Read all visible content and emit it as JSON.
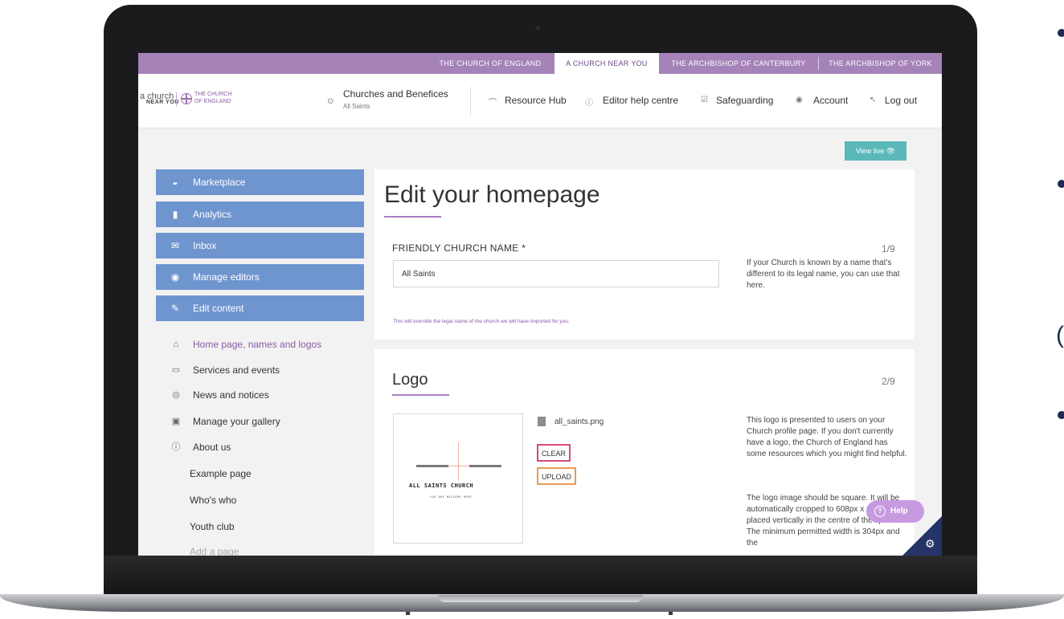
{
  "topbar": {
    "links": [
      {
        "label": "THE CHURCH OF ENGLAND"
      },
      {
        "label": "A CHURCH NEAR YOU"
      },
      {
        "label": "THE ARCHBISHOP OF CANTERBURY"
      },
      {
        "label": "THE ARCHBISHOP OF YORK"
      }
    ],
    "active_index": 1
  },
  "header": {
    "logo": {
      "line_a": "a church",
      "line_b": "NEAR YOU",
      "coe_1": "THE CHURCH",
      "coe_2": "OF ENGLAND"
    },
    "churches": {
      "title": "Churches and Benefices",
      "subtitle": "All Saints"
    },
    "nav": {
      "resource_hub": "Resource Hub",
      "editor_help": "Editor help centre",
      "safeguarding": "Safeguarding",
      "account": "Account",
      "log_out": "Log out"
    },
    "view_live": "View live"
  },
  "sidebar": {
    "buttons": [
      {
        "label": "Marketplace",
        "icon": "basket-icon"
      },
      {
        "label": "Analytics",
        "icon": "bar-chart-icon"
      },
      {
        "label": "Inbox",
        "icon": "envelope-icon"
      },
      {
        "label": "Manage editors",
        "icon": "user-circle-icon"
      },
      {
        "label": "Edit content",
        "icon": "pencil-icon"
      }
    ],
    "links": [
      {
        "label": "Home page, names and logos",
        "icon": "home-icon"
      },
      {
        "label": "Services and events",
        "icon": "calendar-icon"
      },
      {
        "label": "News and notices",
        "icon": "broadcast-icon"
      },
      {
        "label": "Manage your gallery",
        "icon": "image-icon"
      },
      {
        "label": "About us",
        "icon": "info-icon"
      }
    ],
    "sub_links": [
      "Example page",
      "Who's who",
      "Youth club",
      "Add a page"
    ]
  },
  "main": {
    "page_title": "Edit your homepage",
    "name_section": {
      "label": "FRIENDLY CHURCH NAME *",
      "step": "1/9",
      "value": "All Saints",
      "help": "If your Church is known by a name that's different to its legal name, you can use that here.",
      "hint": "This will override the legal name of the church we will have imported for you."
    },
    "logo_section": {
      "title": "Logo",
      "step": "2/9",
      "preview_name": "ALL SAINTS CHURCH",
      "preview_tagline": "YOU ARE WELCOME HERE",
      "file_name": "all_saints.png",
      "clear_label": "CLEAR",
      "upload_label": "UPLOAD",
      "help_1": "This logo is presented to users on your Church profile page. If you don't currently have a logo, the Church of England has some resources which you might find helpful.",
      "help_2": "The logo image should be square. It will be automatically cropped to 608px x 608px and placed vertically in the centre of the space. The minimum permitted width is 304px and the"
    }
  },
  "help_button": "Help",
  "colors": {
    "topbar": "#a582b8",
    "sidebar_button": "#6f95cf",
    "accent_purple": "#a97fc3",
    "view_live": "#5ab8b9",
    "clear_border": "#d64b7a",
    "upload_border": "#ea9a55",
    "help_button": "#c79ae0",
    "corner": "#243468"
  }
}
